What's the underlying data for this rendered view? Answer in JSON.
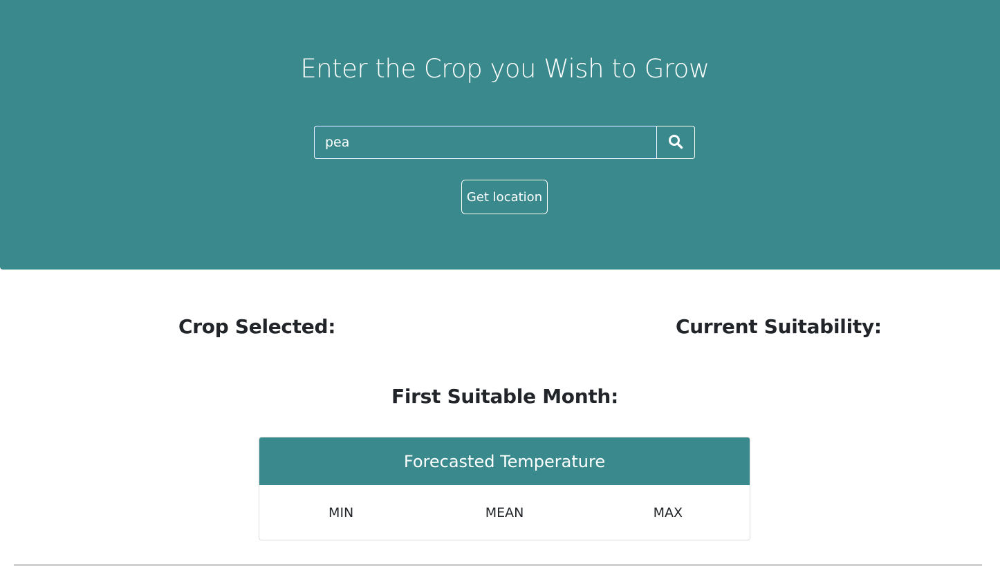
{
  "hero": {
    "title": "Enter the Crop you Wish to Grow",
    "search_value": "pea",
    "search_icon": "search-icon",
    "location_button": "Get location",
    "accent_color": "#3a898c"
  },
  "results": {
    "crop_selected_label": "Crop Selected:",
    "current_suitability_label": "Current Suitability:",
    "first_suitable_month_label": "First Suitable Month:"
  },
  "forecast": {
    "title": "Forecasted Temperature",
    "columns": [
      "MIN",
      "MEAN",
      "MAX"
    ]
  }
}
